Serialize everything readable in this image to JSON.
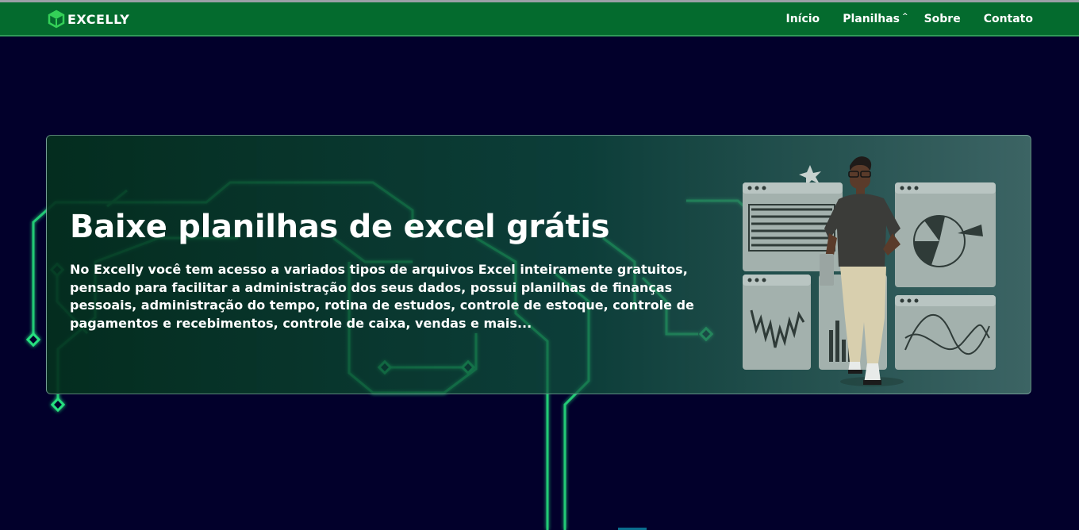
{
  "brand": {
    "name": "EXCELLY",
    "logo_icon": "cube-icon",
    "color": "#046b2e"
  },
  "nav": {
    "items": [
      {
        "label": "Início"
      },
      {
        "label": "Planilhas",
        "dropdown_icon": "chevron-up-icon"
      },
      {
        "label": "Sobre"
      },
      {
        "label": "Contato"
      }
    ]
  },
  "hero": {
    "title": "Baixe planilhas de excel grátis",
    "description": "No Excelly você tem acesso a variados tipos de arquivos Excel inteiramente gratuitos, pensado para facilitar a administração dos seus dados, possui planilhas de finanças pessoais, administração do tempo, rotina de estudos, controle de estoque, controle de pagamentos e recebimentos, controle de caixa, vendas e mais..."
  },
  "colors": {
    "background": "#02002b",
    "navbar": "#046b2e",
    "circuit": "#27e07f",
    "panel": "#a3b1ad"
  }
}
